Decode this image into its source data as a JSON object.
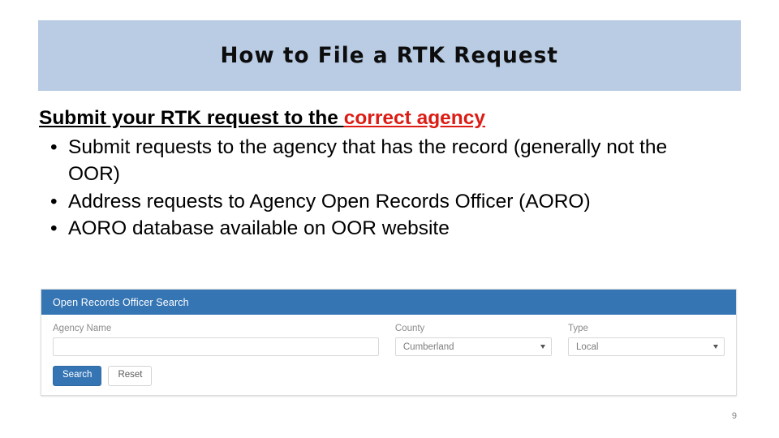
{
  "slide": {
    "title": "How to File a RTK Request",
    "banner_color": "#b9cce4",
    "page_number": "9"
  },
  "content": {
    "lead_black": "Submit your RTK request to the ",
    "lead_red": "correct agency",
    "bullets": [
      {
        "marker": "•",
        "text": "Submit requests to the agency that has the record (generally not the OOR)"
      },
      {
        "marker": "•",
        "text": "Address requests to Agency Open Records Officer (AORO)"
      },
      {
        "marker": "•",
        "text": "AORO database available on OOR website"
      }
    ],
    "accent_red": "#dc1c14"
  },
  "embedded_app": {
    "header_title": "Open Records Officer Search",
    "header_color": "#3575b4",
    "fields": {
      "agency": {
        "label": "Agency Name",
        "value": "",
        "placeholder": ""
      },
      "county": {
        "label": "County",
        "value": "Cumberland"
      },
      "type": {
        "label": "Type",
        "value": "Local"
      }
    },
    "buttons": {
      "search": "Search",
      "reset": "Reset"
    }
  }
}
